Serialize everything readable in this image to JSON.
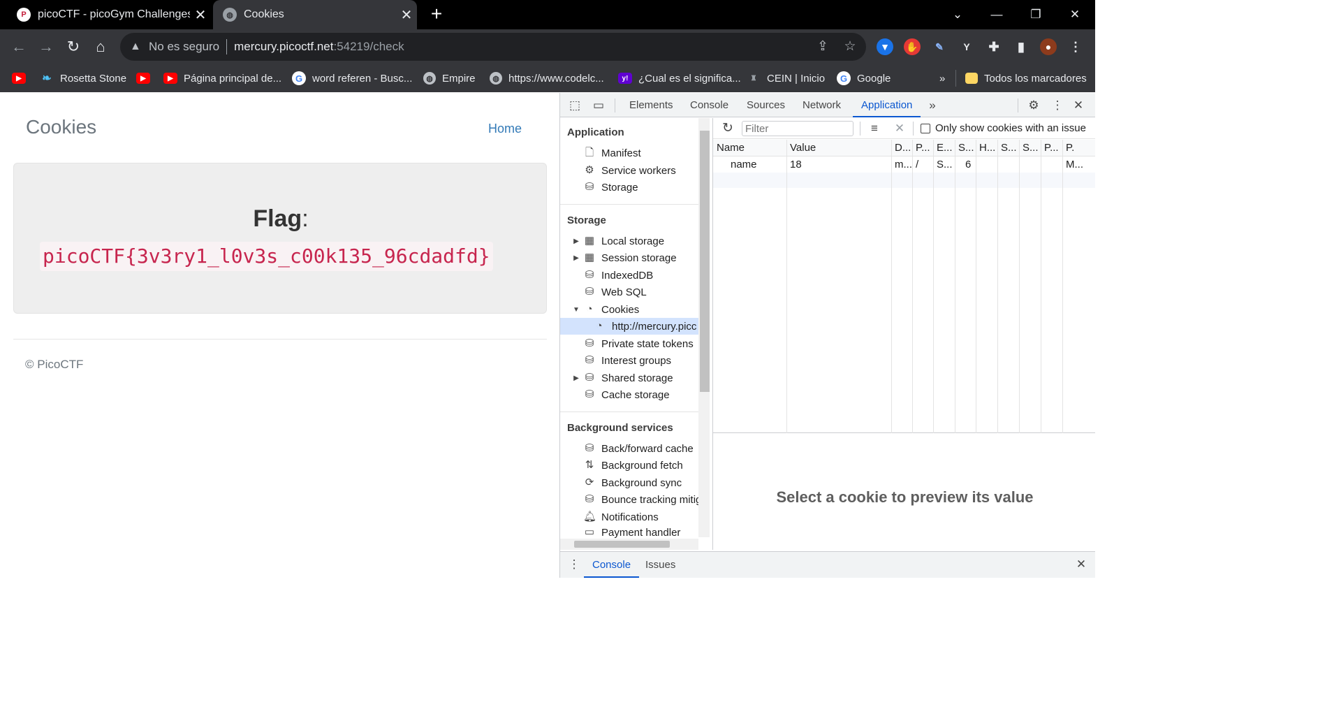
{
  "browser": {
    "tabs": [
      {
        "title": "picoCTF - picoGym Challenges",
        "favicon": "picoctf-icon"
      },
      {
        "title": "Cookies",
        "favicon": "globe-icon"
      }
    ],
    "omnibox": {
      "security": "No es seguro",
      "host": "mercury.picoctf.net",
      "path": ":54219/check"
    },
    "bookmarks": [
      {
        "label": "",
        "icon": "youtube-icon"
      },
      {
        "label": "Rosetta Stone",
        "icon": "rosetta-icon"
      },
      {
        "label": "",
        "icon": "youtube-icon"
      },
      {
        "label": "Página principal de...",
        "icon": "youtube-icon"
      },
      {
        "label": "word referen - Busc...",
        "icon": "google-icon"
      },
      {
        "label": "Empire",
        "icon": "globe-icon"
      },
      {
        "label": "https://www.codelc...",
        "icon": "globe-icon"
      },
      {
        "label": "¿Cual es el significa...",
        "icon": "yahoo-icon"
      },
      {
        "label": "CEIN | Inicio",
        "icon": "cein-icon"
      },
      {
        "label": "Google",
        "icon": "google-icon"
      }
    ],
    "bookmarks_overflow": "»",
    "all_bookmarks": "Todos los marcadores"
  },
  "page": {
    "title": "Cookies",
    "home_link": "Home",
    "flag_label": "Flag",
    "flag_colon": ":",
    "flag_value": "picoCTF{3v3ry1_l0v3s_c00k135_96cdadfd}",
    "footer": "© PicoCTF"
  },
  "devtools": {
    "tabs": [
      "Elements",
      "Console",
      "Sources",
      "Network",
      "Application"
    ],
    "active_tab": "Application",
    "sidebar": {
      "application_header": "Application",
      "application_items": [
        "Manifest",
        "Service workers",
        "Storage"
      ],
      "storage_header": "Storage",
      "storage_items": [
        "Local storage",
        "Session storage",
        "IndexedDB",
        "Web SQL",
        "Cookies",
        "http://mercury.picc",
        "Private state tokens",
        "Interest groups",
        "Shared storage",
        "Cache storage"
      ],
      "background_header": "Background services",
      "background_items": [
        "Back/forward cache",
        "Background fetch",
        "Background sync",
        "Bounce tracking mitig",
        "Notifications",
        "Payment handler"
      ]
    },
    "cookies": {
      "filter_placeholder": "Filter",
      "only_issues_label": "Only show cookies with an issue",
      "columns": [
        "Name",
        "Value",
        "D...",
        "P...",
        "E...",
        "S...",
        "H...",
        "S...",
        "S...",
        "P...",
        "P."
      ],
      "rows": [
        [
          "name",
          "18",
          "m...",
          "/",
          "S...",
          "6",
          "",
          "",
          "",
          "",
          "M..."
        ]
      ],
      "preview_message": "Select a cookie to preview its value"
    },
    "drawer_tabs": [
      "Console",
      "Issues"
    ]
  }
}
